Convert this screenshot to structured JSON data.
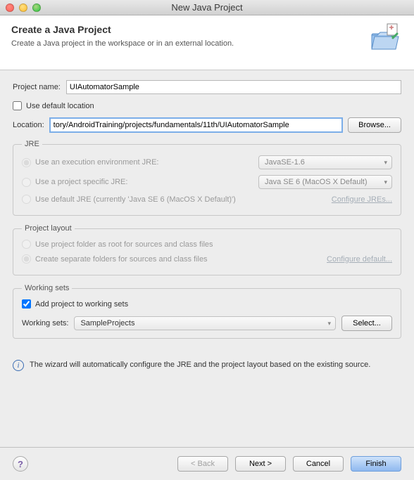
{
  "window": {
    "title": "New Java Project"
  },
  "header": {
    "title": "Create a Java Project",
    "subtitle": "Create a Java project in the workspace or in an external location."
  },
  "project": {
    "name_label": "Project name:",
    "name_value": "UIAutomatorSample",
    "use_default_label": "Use default location",
    "location_label": "Location:",
    "location_value": "tory/AndroidTraining/projects/fundamentals/11th/UIAutomatorSample",
    "browse_label": "Browse..."
  },
  "jre": {
    "legend": "JRE",
    "env_label": "Use an execution environment JRE:",
    "env_value": "JavaSE-1.6",
    "specific_label": "Use a project specific JRE:",
    "specific_value": "Java SE 6 (MacOS X Default)",
    "default_label": "Use default JRE (currently 'Java SE 6 (MacOS X Default)')",
    "configure_link": "Configure JREs..."
  },
  "layout": {
    "legend": "Project layout",
    "root_label": "Use project folder as root for sources and class files",
    "separate_label": "Create separate folders for sources and class files",
    "configure_link": "Configure default..."
  },
  "working_sets": {
    "legend": "Working sets",
    "add_label": "Add project to working sets",
    "sets_label": "Working sets:",
    "sets_value": "SampleProjects",
    "select_label": "Select..."
  },
  "info": {
    "text": "The wizard will automatically configure the JRE and the project layout based on the existing source."
  },
  "buttons": {
    "back": "< Back",
    "next": "Next >",
    "cancel": "Cancel",
    "finish": "Finish"
  }
}
